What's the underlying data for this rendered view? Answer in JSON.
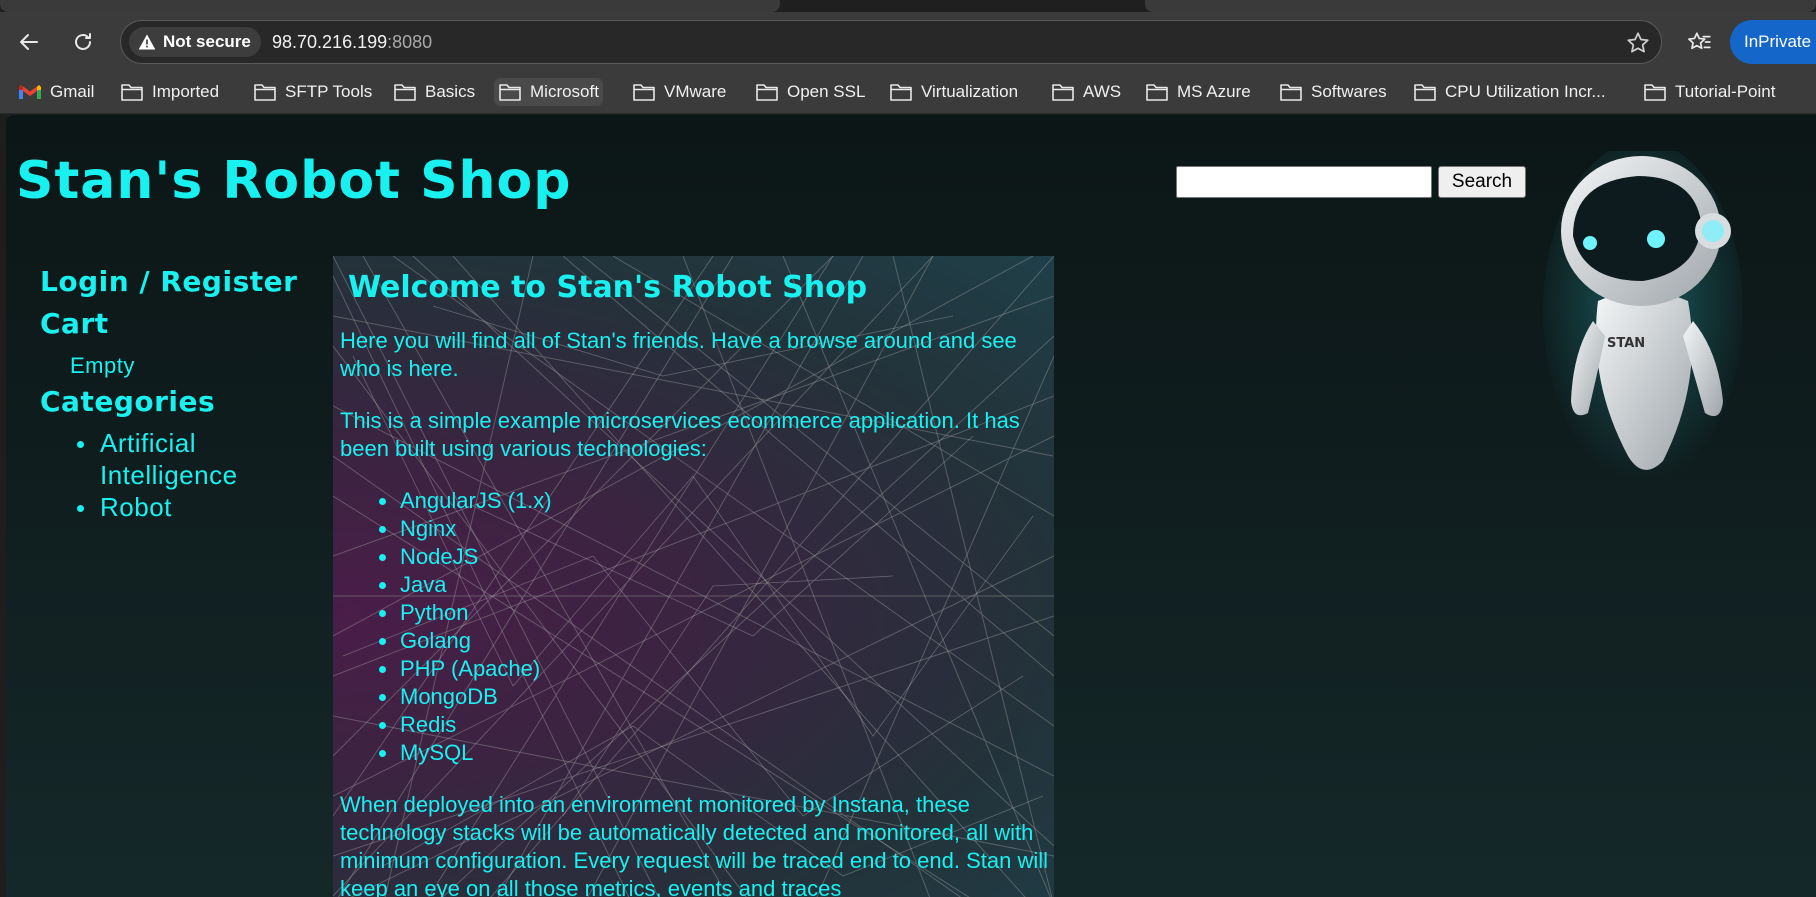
{
  "browser": {
    "security_label": "Not secure",
    "url_host": "98.70.216.199",
    "url_port": ":8080",
    "inprivate_label": "InPrivate",
    "icons": [
      "back-icon",
      "refresh-icon",
      "warning-icon",
      "star-icon",
      "favorites-icon",
      "gmail-icon",
      "folder-icon"
    ]
  },
  "bookmarks": {
    "gmail": "Gmail",
    "imported": "Imported",
    "sftp_tools": "SFTP Tools",
    "basics": "Basics",
    "microsoft": "Microsoft",
    "vmware": "VMware",
    "open_ssl": "Open SSL",
    "virtualization": "Virtualization",
    "aws": "AWS",
    "ms_azure": "MS Azure",
    "softwares": "Softwares",
    "cpu_utilization": "CPU Utilization Incr...",
    "tutorial_point": "Tutorial-Point"
  },
  "page": {
    "title": "Stan's Robot Shop",
    "search_button": "Search",
    "search_value": "",
    "robot_badge": "STAN",
    "sidebar": {
      "login": "Login / Register",
      "cart_heading": "Cart",
      "cart_status": "Empty",
      "categories_heading": "Categories",
      "categories": [
        "Artificial Intelligence",
        "Robot"
      ]
    },
    "welcome": {
      "heading": "Welcome to Stan's Robot Shop",
      "intro": "Here you will find all of Stan's friends. Have a browse around and see who is here.",
      "description": "This is a simple example microservices ecommerce application. It has been built using various technologies:",
      "technologies": [
        "AngularJS (1.x)",
        "Nginx",
        "NodeJS",
        "Java",
        "Python",
        "Golang",
        "PHP (Apache)",
        "MongoDB",
        "Redis",
        "MySQL"
      ],
      "monitoring": "When deployed into an environment monitored by Instana, these technology stacks will be automatically detected and monitored, all with minimum configuration. Every request will be traced end to end. Stan will keep an eye on all those metrics, events and traces"
    },
    "colors": {
      "accent": "#19f0f0",
      "background": "#0f1c1d",
      "inprivate": "#1467c9"
    }
  }
}
